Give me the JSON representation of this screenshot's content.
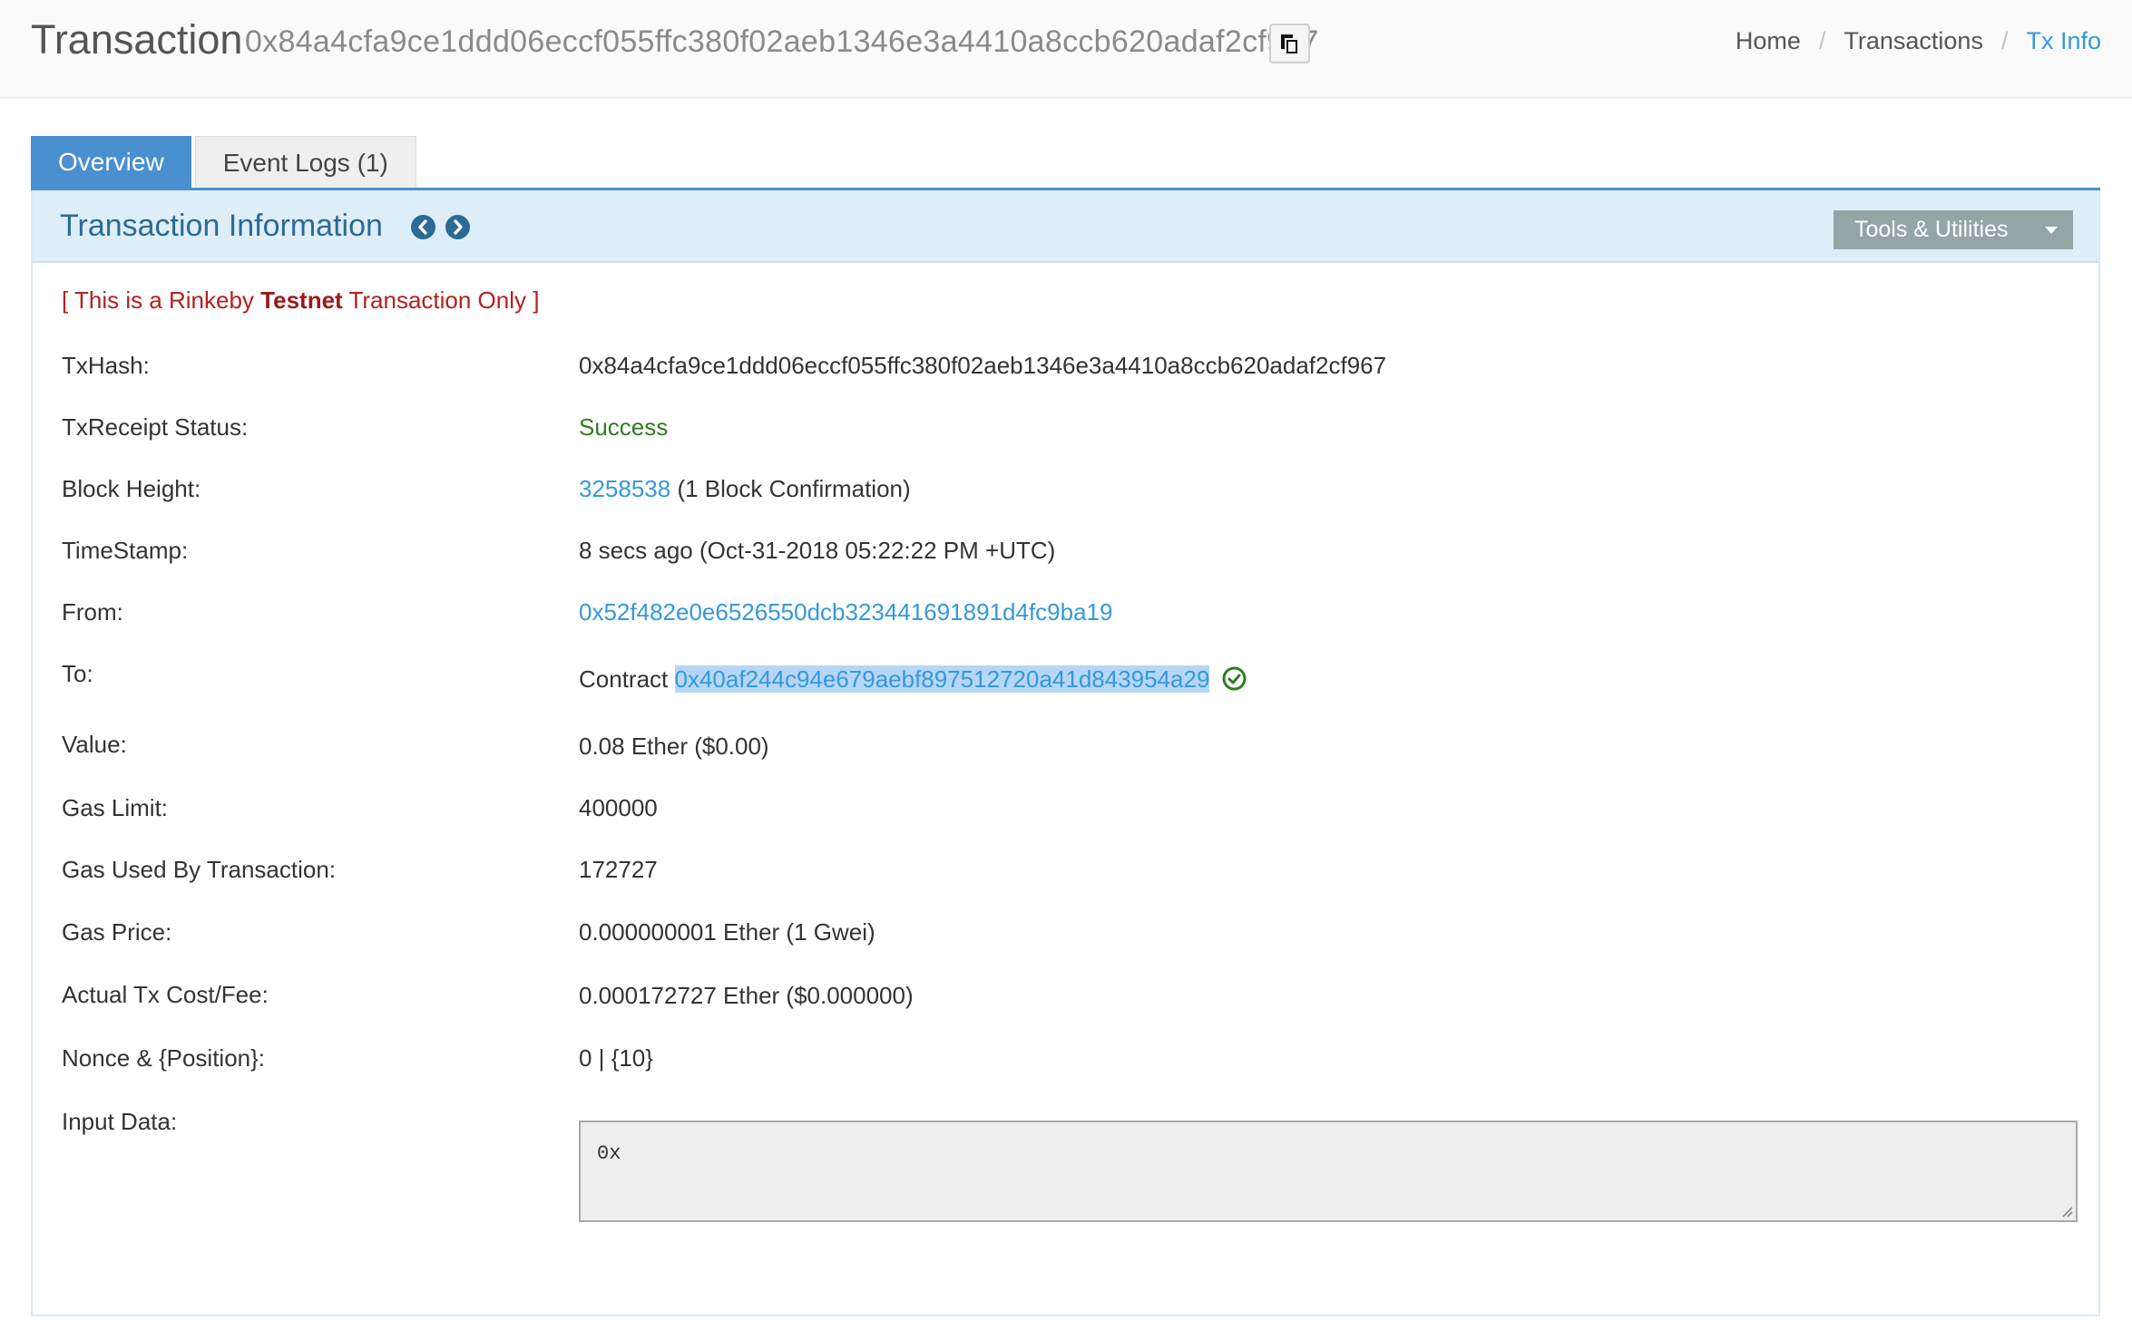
{
  "header": {
    "title": "Transaction",
    "hash": "0x84a4cfa9ce1ddd06eccf055ffc380f02aeb1346e3a4410a8ccb620adaf2cf967",
    "copy_icon": "copy-icon",
    "breadcrumb": {
      "home": "Home",
      "sep1": "/",
      "transactions": "Transactions",
      "sep2": "/",
      "current": "Tx Info"
    }
  },
  "tabs": {
    "overview": "Overview",
    "event_logs": "Event Logs (1)"
  },
  "panel": {
    "title": "Transaction Information",
    "prev_icon": "chevron-left-circle-icon",
    "next_icon": "chevron-right-circle-icon",
    "tools_label": "Tools & Utilities"
  },
  "notice": {
    "prefix": "[ This is a Rinkeby ",
    "bold": "Testnet",
    "suffix": " Transaction Only ]"
  },
  "fields": {
    "txhash": {
      "label": "TxHash:",
      "value": "0x84a4cfa9ce1ddd06eccf055ffc380f02aeb1346e3a4410a8ccb620adaf2cf967"
    },
    "status": {
      "label": "TxReceipt Status:",
      "value": "Success"
    },
    "block": {
      "label": "Block Height:",
      "link": "3258538",
      "suffix": " (1 Block Confirmation)"
    },
    "timestamp": {
      "label": "TimeStamp:",
      "value": "8 secs ago (Oct-31-2018 05:22:22 PM +UTC)"
    },
    "from": {
      "label": "From:",
      "value": "0x52f482e0e6526550dcb323441691891d4fc9ba19"
    },
    "to": {
      "label": "To:",
      "prefix": "Contract ",
      "value": "0x40af244c94e679aebf897512720a41d843954a29",
      "icon": "check-circle-icon"
    },
    "value": {
      "label": "Value:",
      "value": "0.08 Ether ($0.00)"
    },
    "gas_limit": {
      "label": "Gas Limit:",
      "value": "400000"
    },
    "gas_used": {
      "label": "Gas Used By Transaction:",
      "value": "172727"
    },
    "gas_price": {
      "label": "Gas Price:",
      "value": "0.000000001 Ether (1 Gwei)"
    },
    "tx_fee": {
      "label": "Actual Tx Cost/Fee:",
      "value": "0.000172727 Ether ($0.000000)"
    },
    "nonce": {
      "label": "Nonce & {Position}:",
      "value": "0 | {10}"
    },
    "input": {
      "label": "Input Data:",
      "value": "0x"
    }
  },
  "colors": {
    "accent": "#4a8fcf",
    "link": "#3598dc",
    "success": "#2e7d1f",
    "notice": "#b5201f",
    "panel_header": "#deeef8"
  }
}
